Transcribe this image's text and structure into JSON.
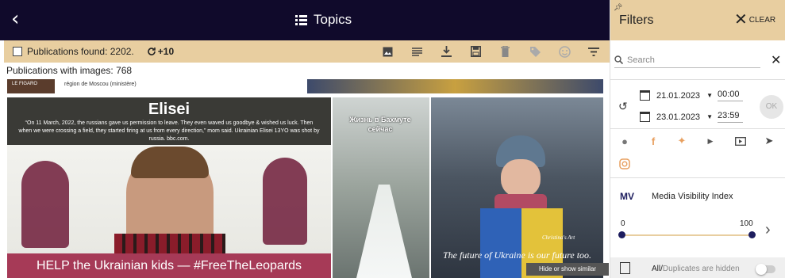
{
  "header": {
    "title": "Topics",
    "back_icon": "chevron-left-icon"
  },
  "toolbar": {
    "found_label": "Publications found: 2202.",
    "refresh_label": "+10",
    "icons": [
      "image-icon",
      "text-icon",
      "download-icon",
      "save-icon",
      "delete-icon",
      "tag-icon",
      "sentiment-icon",
      "filter-icon"
    ]
  },
  "publications_images_label": "Publications with images: 768",
  "strip": {
    "badge": "LE FIGARO",
    "text": "région de Moscou (ministère)"
  },
  "cards": [
    {
      "name": "Elisei",
      "quote": "“On 11 March, 2022, the russians gave us permission to leave. They even waved us goodbye & wished us luck. Then when we were crossing a field, they started firing at us from every direction,” mom said. Ukrainian Elisei 13YO was shot by russia. bbc.com.",
      "banner": "HELP the Ukrainian kids — #FreeTheLeopards"
    },
    {
      "caption": "Жизнь в Бахмуте сейчас"
    },
    {
      "caption": "The future of Ukraine is our future too.",
      "signature": "Christina's Art"
    }
  ],
  "tooltip": "Hide or show similar mentions",
  "filters": {
    "title": "Filters",
    "clear_label": "CLEAR",
    "search_placeholder": "Search",
    "date_from": "21.01.2023",
    "time_from": "00:00",
    "date_to": "23.01.2023",
    "time_to": "23:59",
    "ok_label": "OK",
    "social_icons": [
      "web-icon",
      "facebook-icon",
      "twitter-icon",
      "youtube-icon",
      "video-icon",
      "telegram-icon",
      "instagram-icon"
    ],
    "mv_label": "MV",
    "mv_text": "Media Visibility Index",
    "slider_min": "0",
    "slider_max": "100",
    "slider_value": [
      0,
      100
    ],
    "dup_label_a": "All/",
    "dup_label_b": "Duplicates are hidden"
  },
  "colors": {
    "topbar": "#100a2b",
    "accent": "#e8cea0",
    "banner": "#a63a57",
    "mv": "#1d1d5e"
  }
}
